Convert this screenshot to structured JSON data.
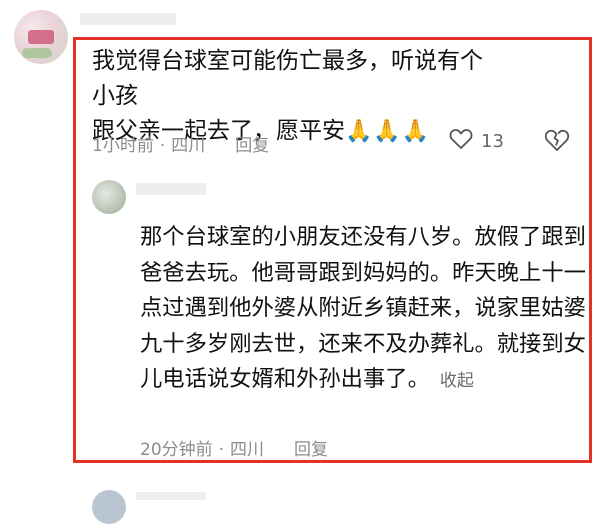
{
  "comment": {
    "text_line1": "我觉得台球室可能伤亡最多，听说有个小孩",
    "text_line2": "跟父亲一起去了，愿平安",
    "emoji": "🙏🙏🙏",
    "time": "1小时前",
    "location": "四川",
    "reply_label": "回复",
    "like_count": "13"
  },
  "reply": {
    "text": "那个台球室的小朋友还没有八岁。放假了跟到爸爸去玩。他哥哥跟到妈妈的。昨天晚上十一点过遇到他外婆从附近乡镇赶来，说家里姑婆九十多岁刚去世，还来不及办葬礼。就接到女儿电话说女婿和外孙出事了。",
    "collapse_label": "收起",
    "time": "20分钟前",
    "location": "四川",
    "reply_label": "回复"
  },
  "icons": {
    "like": "heart-outline-icon",
    "dislike": "broken-heart-icon",
    "highlight_color": "#e53226"
  }
}
